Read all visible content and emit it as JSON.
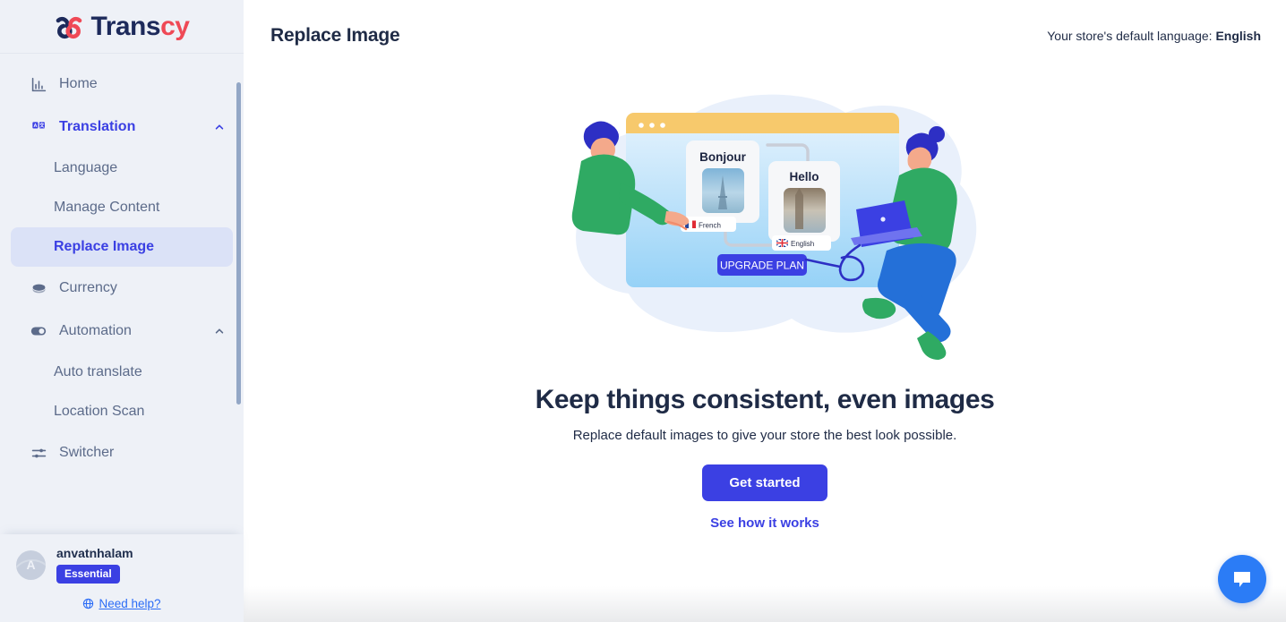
{
  "brand": {
    "name_part1": "Trans",
    "name_part2": "cy",
    "logo_icon": "interlocking-loops-icon",
    "navy": "#1d2a5b",
    "red": "#ef4956",
    "accent": "#3b40e3"
  },
  "sidebar": {
    "items": [
      {
        "label": "Home",
        "icon": "bar-chart-icon",
        "level": "top",
        "state": "default"
      },
      {
        "label": "Translation",
        "icon": "translate-icon",
        "level": "top",
        "state": "expanded-active",
        "chevron": "chevron-up-icon"
      },
      {
        "label": "Language",
        "icon": "",
        "level": "sub",
        "state": "default"
      },
      {
        "label": "Manage Content",
        "icon": "",
        "level": "sub",
        "state": "default"
      },
      {
        "label": "Replace Image",
        "icon": "",
        "level": "sub",
        "state": "selected"
      },
      {
        "label": "Currency",
        "icon": "coin-icon",
        "level": "top",
        "state": "default"
      },
      {
        "label": "Automation",
        "icon": "toggle-switch-icon",
        "level": "top",
        "state": "expanded",
        "chevron": "chevron-up-icon"
      },
      {
        "label": "Auto translate",
        "icon": "",
        "level": "sub",
        "state": "default"
      },
      {
        "label": "Location Scan",
        "icon": "",
        "level": "sub",
        "state": "default"
      },
      {
        "label": "Switcher",
        "icon": "sliders-icon",
        "level": "top",
        "state": "default"
      }
    ],
    "footer": {
      "avatar_initial": "A",
      "user_name": "anvatnhalam",
      "plan_badge": "Essential",
      "help_label": "Need help?",
      "help_icon": "globe-icon"
    }
  },
  "header": {
    "title": "Replace Image",
    "store_language_prefix": "Your store's default language:",
    "store_language_value": "English"
  },
  "empty_state": {
    "title": "Keep things consistent, even images",
    "subtitle": "Replace default images to give your store the best look possible.",
    "primary_button": "Get started",
    "secondary_link": "See how it works",
    "illustration": {
      "name": "translation-images-illustration",
      "window_dots": 3,
      "card_left_text": "Bonjour",
      "card_left_flag": "french-flag-icon",
      "card_left_flag_label": "French",
      "card_left_photo": "eiffel-tower-photo",
      "card_right_text": "Hello",
      "card_right_flag": "uk-flag-icon",
      "card_right_flag_label": "English",
      "card_right_photo": "big-ben-photo",
      "cta_chip": "UPGRADE PLAN"
    }
  },
  "chat_widget": {
    "icon": "chat-bubble-icon",
    "color": "#2b7cf6"
  }
}
